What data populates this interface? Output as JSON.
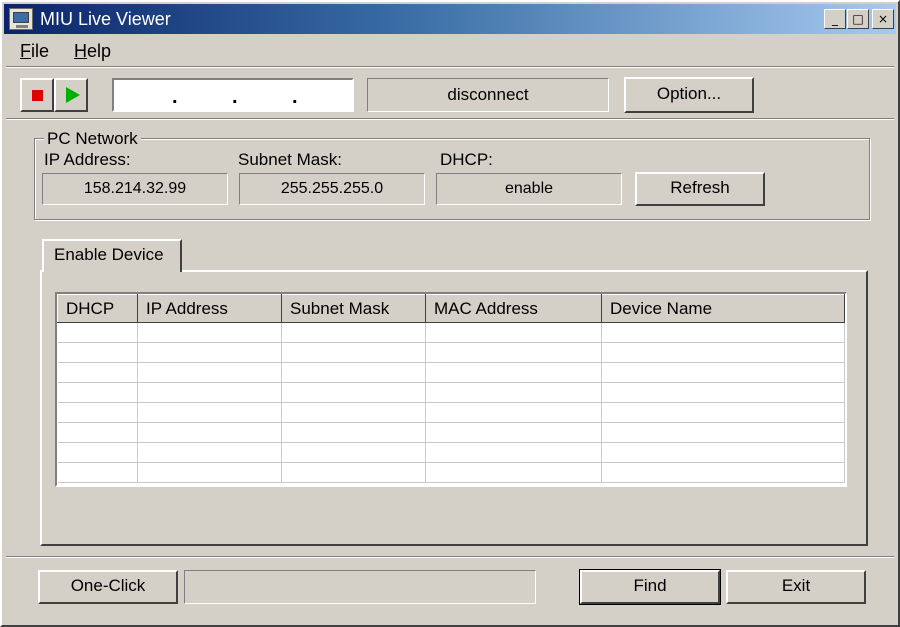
{
  "window": {
    "title": "MIU Live Viewer",
    "controls": {
      "minimize": "_",
      "maximize": "□",
      "close": "×"
    }
  },
  "menu": {
    "items": [
      {
        "mnemonic": "F",
        "rest": "ile"
      },
      {
        "mnemonic": "H",
        "rest": "elp"
      }
    ]
  },
  "toolbar": {
    "stop_icon": "stop-icon",
    "play_icon": "play-icon",
    "ip_input_value": ". . .",
    "connection_status": "disconnect",
    "option_label": "Option..."
  },
  "pc_network": {
    "legend": "PC Network",
    "ip_label": "IP Address:",
    "ip_value": "158.214.32.99",
    "subnet_label": "Subnet Mask:",
    "subnet_value": "255.255.255.0",
    "dhcp_label": "DHCP:",
    "dhcp_value": "enable",
    "refresh_label": "Refresh"
  },
  "tabs": [
    {
      "label": "Enable Device",
      "active": true
    }
  ],
  "device_table": {
    "columns": [
      "DHCP",
      "IP Address",
      "Subnet Mask",
      "MAC Address",
      "Device Name"
    ],
    "rows": []
  },
  "bottom": {
    "oneclick_label": "One-Click",
    "oneclick_status": "",
    "find_label": "Find",
    "exit_label": "Exit"
  },
  "colors": {
    "face": "#d4d0c8",
    "title_start": "#0a246a",
    "title_end": "#a6caf0",
    "stop": "#e00000",
    "play": "#00b000"
  }
}
